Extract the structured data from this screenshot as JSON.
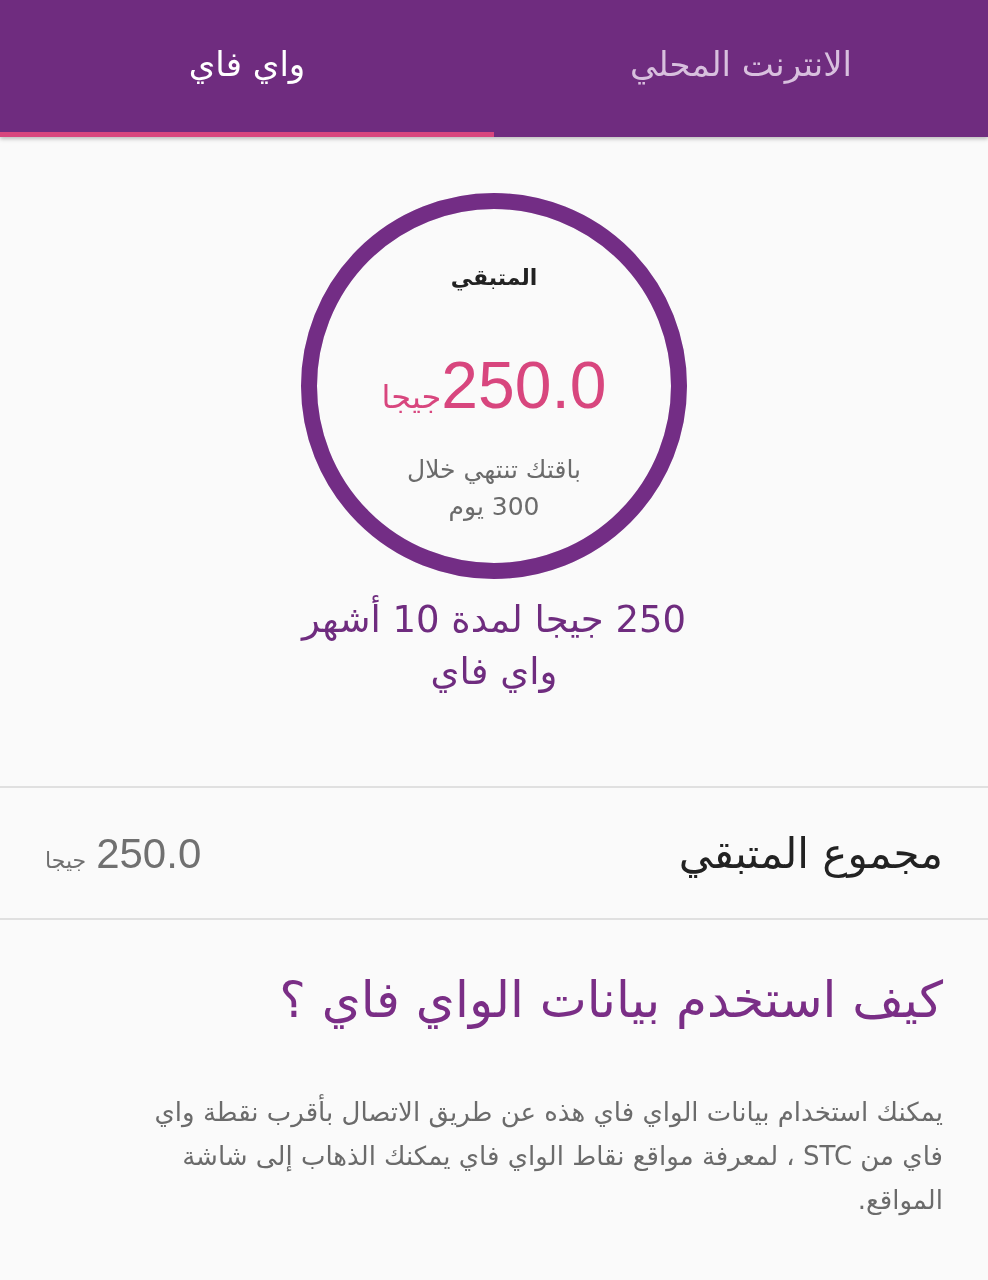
{
  "tabs": [
    {
      "label": "الانترنت المحلي",
      "selected": false
    },
    {
      "label": "واي فاي",
      "selected": true
    }
  ],
  "balance_ring": {
    "level": 1,
    "caption": "المتبقي",
    "amount": "250.0",
    "unit": "جيجا",
    "expiry_lines": [
      "باقتك تنتهي خلال",
      "300 يوم"
    ]
  },
  "package": {
    "title_lines": [
      "250 جيجا لمدة 10 أشهر",
      "واي فاي"
    ]
  },
  "total_remaining": {
    "label": "مجموع المتبقي",
    "amount": "250.0",
    "unit": "جيجا"
  },
  "help": {
    "heading": "كيف استخدم بيانات الواي فاي ؟",
    "body": "يمكنك استخدام بيانات الواي فاي هذه عن طريق الاتصال بأقرب نقطة واي فاي من STC ، لمعرفة مواقع نقاط الواي فاي يمكنك الذهاب إلى شاشة المواقع."
  }
}
